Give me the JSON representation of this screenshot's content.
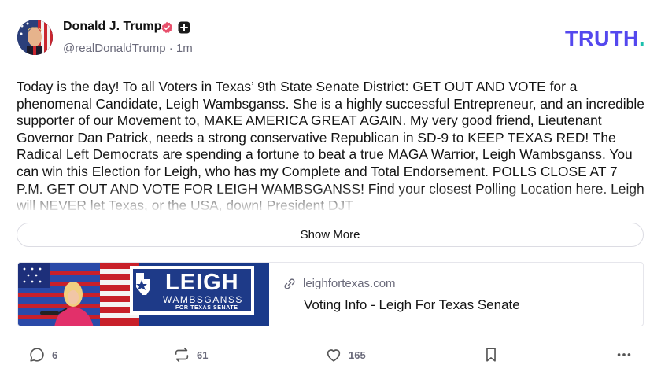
{
  "author": {
    "name": "Donald J. Trump",
    "handle": "@realDonaldTrump",
    "separator": "·",
    "time_ago": "1m"
  },
  "brand": {
    "name": "TRUTH",
    "dot": "."
  },
  "colors": {
    "brand_purple": "#5448ee",
    "brand_teal": "#1cc0ad",
    "verified": "#e8506c"
  },
  "post": {
    "text": "Today is the day! To all Voters in Texas’ 9th State Senate District: GET OUT AND VOTE for a phenomenal Candidate, Leigh Wambsganss. She is a highly successful Entrepreneur, and an incredible supporter of our Movement to, MAKE AMERICA GREAT AGAIN. My very good friend, Lieutenant Governor Dan Patrick, needs a strong conservative Republican in SD-9 to KEEP TEXAS RED! The Radical Left Democrats are spending a fortune to beat a true MAGA Warrior, Leigh Wambsganss. You can win this Election for Leigh, who has my Complete and Total Endorsement. POLLS CLOSE AT 7 P.M. GET OUT AND VOTE FOR LEIGH WAMBSGANSS! Find your closest Polling Location here. Leigh will NEVER let Texas, or the USA, down! President DJT",
    "show_more_label": "Show More"
  },
  "link_card": {
    "image_text_main": "LEIGH",
    "image_text_sub": "WAMBSGANSS",
    "image_text_tag": "FOR TEXAS SENATE",
    "domain": "leighfortexas.com",
    "title": "Voting Info - Leigh For Texas Senate"
  },
  "actions": {
    "replies": "6",
    "retruths": "61",
    "likes": "165"
  },
  "icons": [
    "verified-icon",
    "plus-badge-icon",
    "link-icon",
    "reply-icon",
    "retruth-icon",
    "like-icon",
    "bookmark-icon",
    "more-icon"
  ]
}
